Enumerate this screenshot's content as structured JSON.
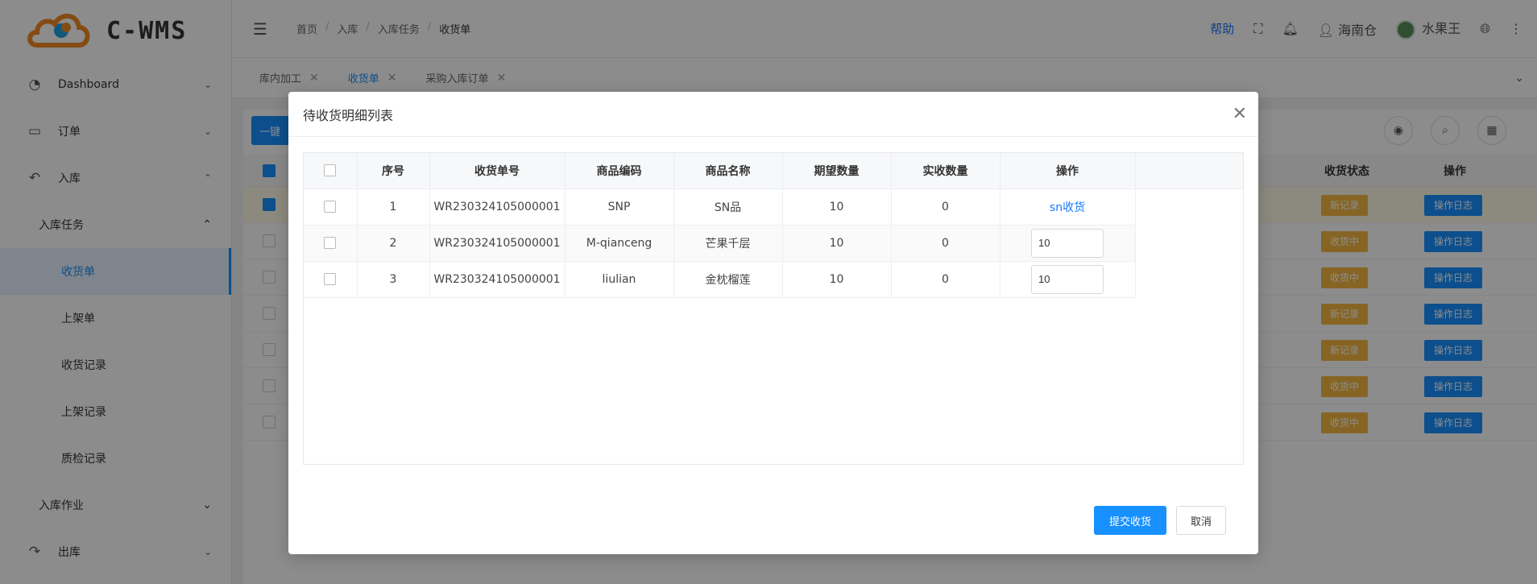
{
  "app": {
    "logo_text": "C-WMS"
  },
  "sidebar": {
    "dashboard": "Dashboard",
    "order": "订单",
    "inbound": "入库",
    "inbound_task": "入库任务",
    "leaves": [
      "收货单",
      "上架单",
      "收货记录",
      "上架记录",
      "质检记录"
    ],
    "inbound_ops": "入库作业",
    "outbound": "出库"
  },
  "breadcrumb": [
    "首页",
    "入库",
    "入库任务",
    "收货单"
  ],
  "header": {
    "help": "帮助",
    "warehouse": "海南仓",
    "user": "水果王"
  },
  "tabs": [
    {
      "label": "库内加工"
    },
    {
      "label": "收货单"
    },
    {
      "label": "采购入库订单"
    }
  ],
  "background": {
    "bulk_button": "一键",
    "col_status": "收货状态",
    "col_action": "操作",
    "rows": [
      {
        "status": "新记录",
        "action": "操作日志"
      },
      {
        "status": "收货中",
        "action": "操作日志"
      },
      {
        "status": "收货中",
        "action": "操作日志"
      },
      {
        "status": "新记录",
        "action": "操作日志"
      },
      {
        "status": "新记录",
        "action": "操作日志"
      },
      {
        "status": "收货中",
        "action": "操作日志"
      },
      {
        "status": "收货中",
        "action": "操作日志"
      }
    ]
  },
  "modal": {
    "title": "待收货明细列表",
    "columns": [
      "序号",
      "收货单号",
      "商品编码",
      "商品名称",
      "期望数量",
      "实收数量",
      "操作"
    ],
    "rows": [
      {
        "index": "1",
        "receipt_no": "WR230324105000001",
        "sku": "SNP",
        "name": "SN品",
        "expected": "10",
        "received": "0",
        "action_link": "sn收货"
      },
      {
        "index": "2",
        "receipt_no": "WR230324105000001",
        "sku": "M-qianceng",
        "name": "芒果千层",
        "expected": "10",
        "received": "0",
        "input_value": "10"
      },
      {
        "index": "3",
        "receipt_no": "WR230324105000001",
        "sku": "liulian",
        "name": "金枕榴莲",
        "expected": "10",
        "received": "0",
        "input_value": "10"
      }
    ],
    "submit": "提交收货",
    "cancel": "取消"
  }
}
